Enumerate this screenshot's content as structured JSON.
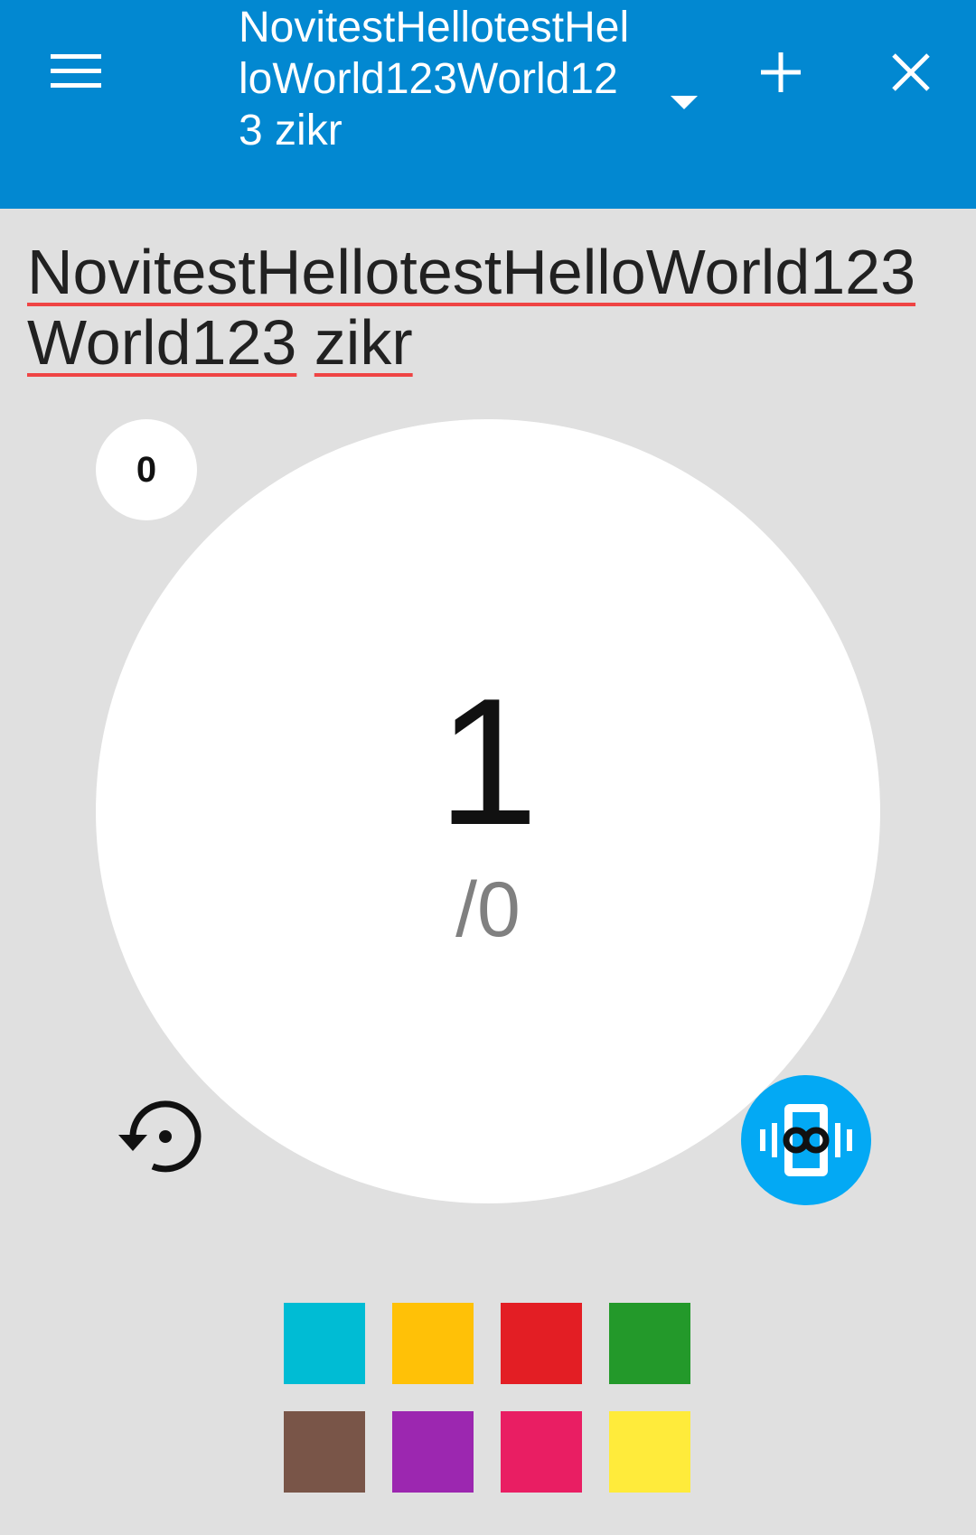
{
  "appbar": {
    "title": "NovitestHellotestHelloWorld123World123 zikr",
    "menu_icon": "hamburger-menu-icon",
    "dropdown_icon": "dropdown-triangle-icon",
    "add_icon": "plus-icon",
    "close_icon": "close-icon",
    "background_color": "#0288d1"
  },
  "zikr": {
    "name_part1": "NovitestHellotestHelloWorld123World123",
    "name_part2": "zikr"
  },
  "counter": {
    "rounds": "0",
    "count": "1",
    "target": "/0"
  },
  "controls": {
    "reset_icon": "reset-restore-icon",
    "vibrate_icon": "vibrate-infinity-icon",
    "vibrate_color": "#03a9f4"
  },
  "palette": {
    "colors": [
      "#00bcd4",
      "#ffc107",
      "#e31e24",
      "#23992a",
      "#795548",
      "#9c27b0",
      "#e91e63",
      "#ffeb3b"
    ]
  }
}
